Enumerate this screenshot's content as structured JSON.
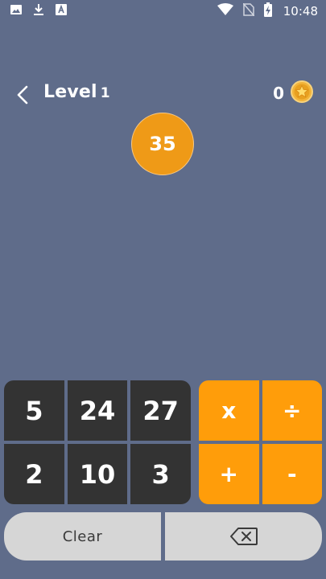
{
  "status_bar": {
    "time": "10:48",
    "icons": [
      "image-icon",
      "download-icon",
      "font-icon",
      "wifi-icon",
      "no-sim-icon",
      "battery-charging-icon"
    ]
  },
  "header": {
    "level_word": "Level",
    "level_number": "1",
    "coin_count": "0",
    "coin_icon": "star-coin-icon"
  },
  "target": {
    "value": "35",
    "color": "#ef9a17"
  },
  "number_keys": [
    "5",
    "24",
    "27",
    "2",
    "10",
    "3"
  ],
  "operator_keys": [
    "x",
    "÷",
    "+",
    "-"
  ],
  "bottom": {
    "clear_label": "Clear",
    "backspace_icon": "backspace-icon"
  },
  "colors": {
    "background": "#5f6c8a",
    "number_key": "#333333",
    "operator_key": "#ff9d0a",
    "bottom_button": "#d6d6d6"
  }
}
